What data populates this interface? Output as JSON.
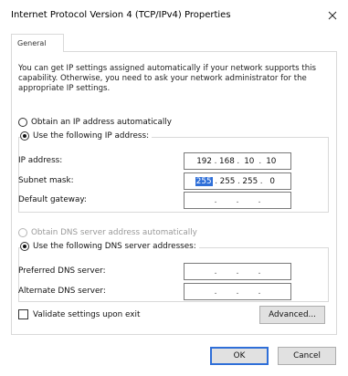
{
  "window": {
    "title": "Internet Protocol Version 4 (TCP/IPv4) Properties"
  },
  "tabs": [
    {
      "label": "General"
    }
  ],
  "description": "You can get IP settings assigned automatically if your network supports this capability. Otherwise, you need to ask your network administrator for the appropriate IP settings.",
  "ip_mode": {
    "auto_label": "Obtain an IP address automatically",
    "manual_label": "Use the following IP address:",
    "selected": "manual"
  },
  "ip_fields": [
    {
      "label": "IP address:",
      "octets": [
        "192",
        "168",
        "10",
        "10"
      ]
    },
    {
      "label": "Subnet mask:",
      "octets": [
        "255",
        "255",
        "255",
        "0"
      ]
    },
    {
      "label": "Default gateway:",
      "octets": [
        "",
        "",
        "",
        ""
      ]
    }
  ],
  "dns_mode": {
    "auto_label": "Obtain DNS server address automatically",
    "manual_label": "Use the following DNS server addresses:",
    "selected": "manual"
  },
  "dns_fields": [
    {
      "label": "Preferred DNS server:",
      "octets": [
        "",
        "",
        "",
        ""
      ]
    },
    {
      "label": "Alternate DNS server:",
      "octets": [
        "",
        "",
        "",
        ""
      ]
    }
  ],
  "validate_label": "Validate settings upon exit",
  "buttons": {
    "advanced": "Advanced...",
    "ok": "OK",
    "cancel": "Cancel"
  },
  "icons": {
    "close": "close-icon"
  }
}
